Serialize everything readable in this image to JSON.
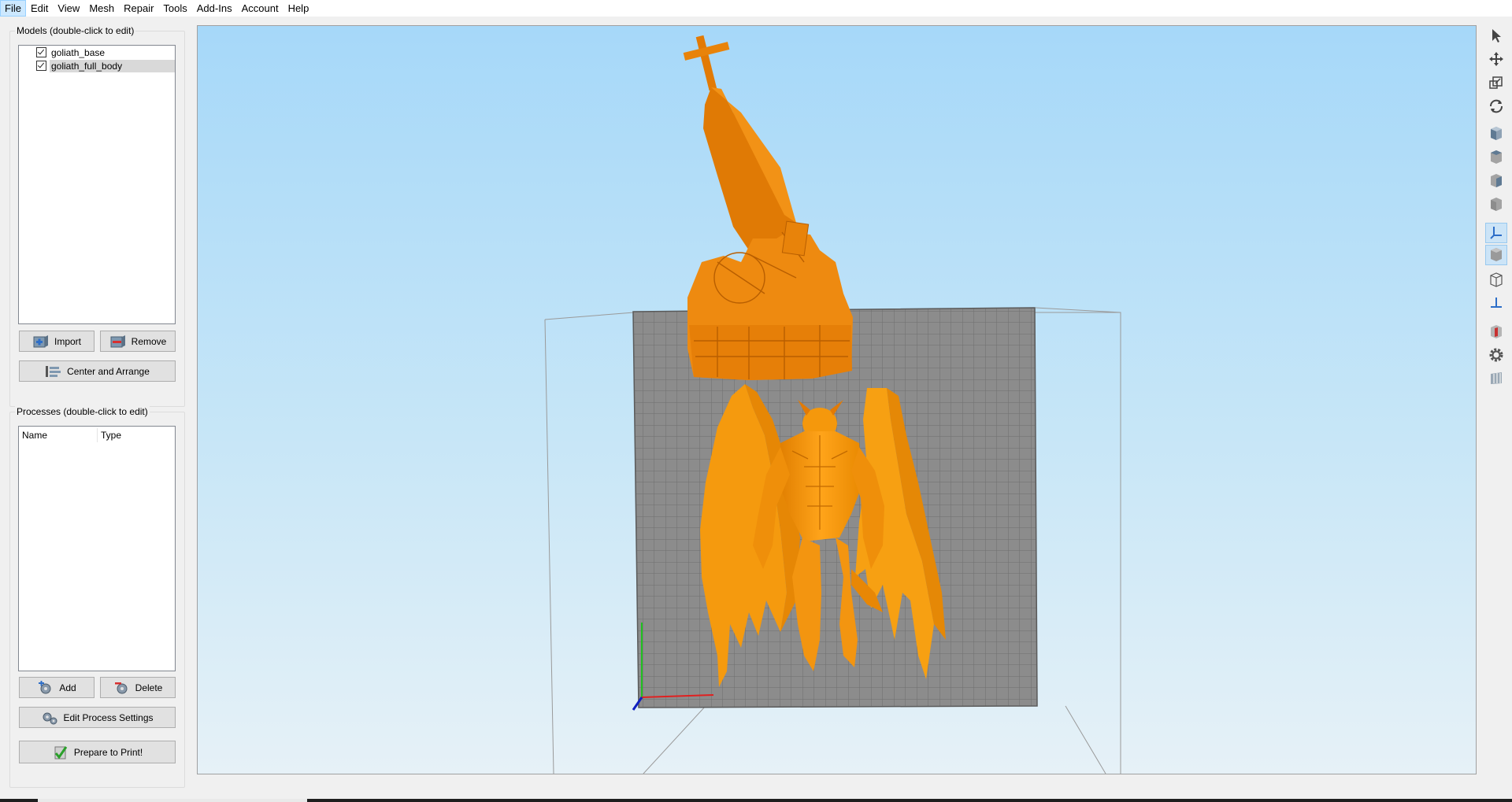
{
  "menu": {
    "items": [
      "File",
      "Edit",
      "View",
      "Mesh",
      "Repair",
      "Tools",
      "Add-Ins",
      "Account",
      "Help"
    ],
    "active": "File"
  },
  "models_panel": {
    "title": "Models (double-click to edit)",
    "items": [
      {
        "name": "goliath_base",
        "checked": true
      },
      {
        "name": "goliath_full_body",
        "checked": true,
        "selected": true
      }
    ],
    "import_label": "Import",
    "remove_label": "Remove",
    "center_arrange_label": "Center and Arrange"
  },
  "processes_panel": {
    "title": "Processes (double-click to edit)",
    "columns": [
      "Name",
      "Type"
    ],
    "rows": [],
    "add_label": "Add",
    "delete_label": "Delete",
    "edit_settings_label": "Edit Process Settings",
    "prepare_label": "Prepare to Print!"
  },
  "viewport": {
    "model_color": "#ff9a0a",
    "model_shadow_color": "#d97200",
    "bed_color": "#8c8c8c",
    "axis_colors": {
      "x": "#e02020",
      "y": "#20c020",
      "z": "#1020c0"
    }
  },
  "toolbar": {
    "tools": [
      "select-icon",
      "move-icon",
      "scale-icon",
      "rotate-icon",
      "view-front-icon",
      "view-top-icon",
      "view-side-icon",
      "view-bottom-icon",
      "show-axes-icon",
      "solid-view-icon",
      "wireframe-view-icon",
      "origin-icon",
      "section-icon",
      "settings-gear-icon",
      "columns-icon"
    ],
    "toggled": [
      "show-axes-icon",
      "solid-view-icon"
    ]
  }
}
